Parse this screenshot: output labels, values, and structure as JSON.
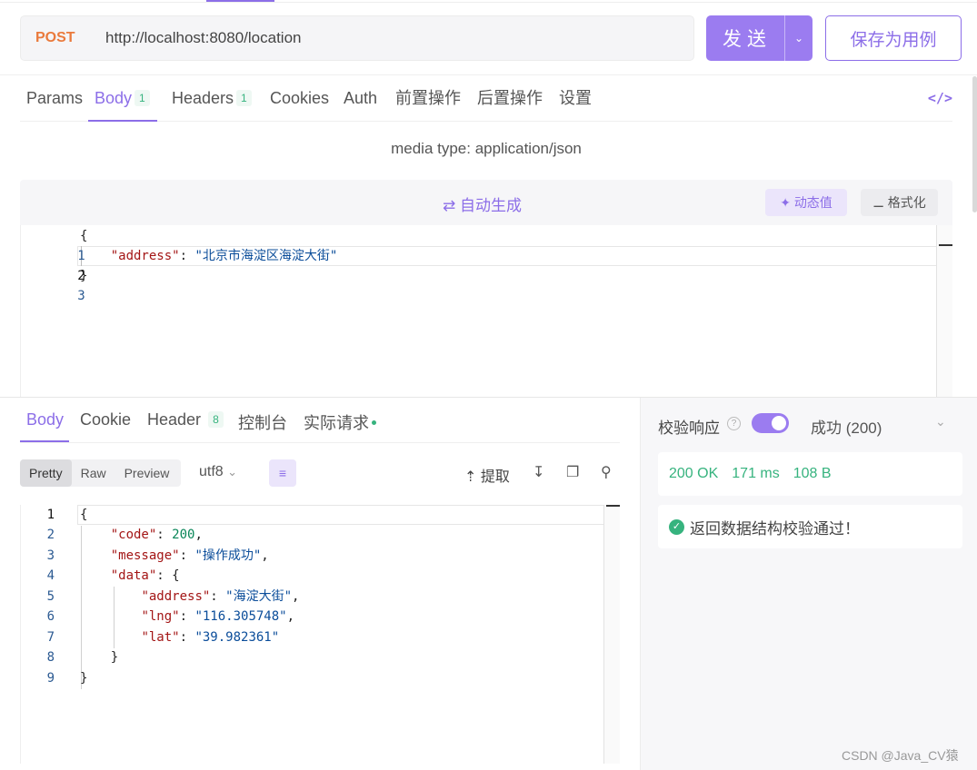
{
  "request": {
    "method": "POST",
    "url": "http://localhost:8080/location",
    "send_label": "发送",
    "save_label": "保存为用例"
  },
  "request_tabs": [
    {
      "label": "Params"
    },
    {
      "label": "Body",
      "badge": "1"
    },
    {
      "label": "Headers",
      "badge": "1"
    },
    {
      "label": "Cookies"
    },
    {
      "label": "Auth"
    },
    {
      "label": "前置操作"
    },
    {
      "label": "后置操作"
    },
    {
      "label": "设置"
    }
  ],
  "code_view_icon": "</>",
  "body": {
    "media_type": "media type: application/json",
    "autogen_label": "自动生成",
    "dynamic_label": "动态值",
    "format_label": "格式化",
    "lines": [
      "1",
      "2",
      "3"
    ],
    "key_address": "\"address\"",
    "val_address": "\"北京市海淀区海淀大街\""
  },
  "response_tabs": [
    {
      "label": "Body"
    },
    {
      "label": "Cookie"
    },
    {
      "label": "Header",
      "badge": "8"
    },
    {
      "label": "控制台"
    },
    {
      "label": "实际请求"
    }
  ],
  "response_toolbar": {
    "views": [
      "Pretty",
      "Raw",
      "Preview"
    ],
    "encoding": "utf8",
    "extract_label": "提取"
  },
  "response_body": {
    "lines": [
      "1",
      "2",
      "3",
      "4",
      "5",
      "6",
      "7",
      "8",
      "9"
    ],
    "k_code": "\"code\"",
    "v_code": "200",
    "k_message": "\"message\"",
    "v_message": "\"操作成功\"",
    "k_data": "\"data\"",
    "k_address": "\"address\"",
    "v_address": "\"海淀大街\"",
    "k_lng": "\"lng\"",
    "v_lng": "\"116.305748\"",
    "k_lat": "\"lat\"",
    "v_lat": "\"39.982361\""
  },
  "validation": {
    "title": "校验响应",
    "enabled": true,
    "status": "成功 (200)",
    "http_status": "200 OK",
    "time": "171 ms",
    "size": "108 B",
    "result": "返回数据结构校验通过！"
  },
  "watermark": "CSDN @Java_CV猿",
  "colors": {
    "accent": "#8c6ee8",
    "method": "#ea7a3c",
    "success": "#36b37e"
  }
}
